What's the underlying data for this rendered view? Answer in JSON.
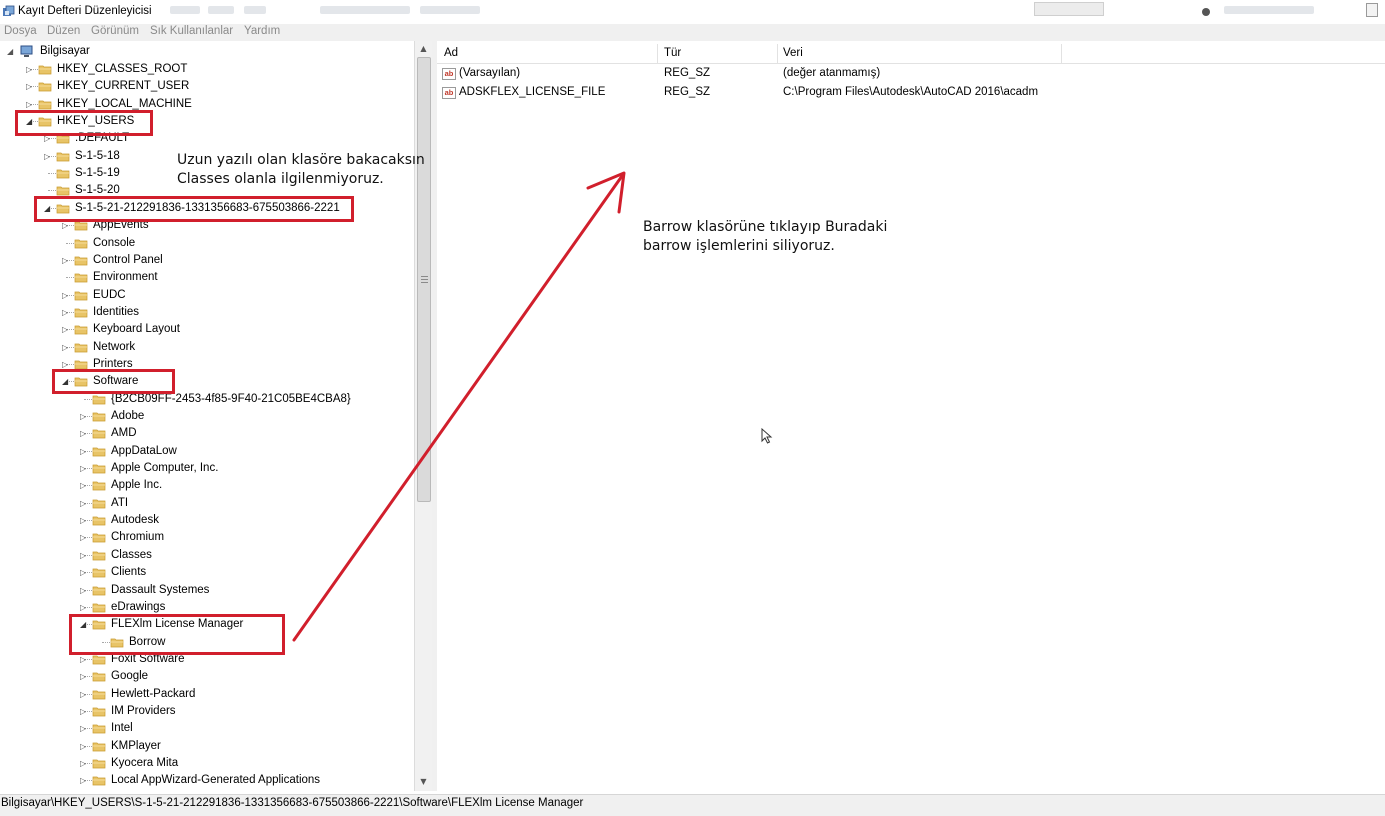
{
  "window": {
    "title": "Kayıt Defteri Düzenleyicisi"
  },
  "menu": [
    "Dosya",
    "Düzen",
    "Görünüm",
    "Sık Kullanılanlar",
    "Yardım"
  ],
  "tree": {
    "root": "Bilgisayar",
    "rows": [
      {
        "label": "HKEY_CLASSES_ROOT",
        "depth": 1,
        "arrow": "closed"
      },
      {
        "label": "HKEY_CURRENT_USER",
        "depth": 1,
        "arrow": "closed"
      },
      {
        "label": "HKEY_LOCAL_MACHINE",
        "depth": 1,
        "arrow": "closed"
      },
      {
        "label": "HKEY_USERS",
        "depth": 1,
        "arrow": "open"
      },
      {
        "label": ".DEFAULT",
        "depth": 2,
        "arrow": "closed"
      },
      {
        "label": "S-1-5-18",
        "depth": 2,
        "arrow": "closed"
      },
      {
        "label": "S-1-5-19",
        "depth": 2,
        "arrow": "none"
      },
      {
        "label": "S-1-5-20",
        "depth": 2,
        "arrow": "none"
      },
      {
        "label": "S-1-5-21-212291836-1331356683-675503866-2221",
        "depth": 2,
        "arrow": "open"
      },
      {
        "label": "AppEvents",
        "depth": 3,
        "arrow": "closed"
      },
      {
        "label": "Console",
        "depth": 3,
        "arrow": "none"
      },
      {
        "label": "Control Panel",
        "depth": 3,
        "arrow": "closed"
      },
      {
        "label": "Environment",
        "depth": 3,
        "arrow": "none"
      },
      {
        "label": "EUDC",
        "depth": 3,
        "arrow": "closed"
      },
      {
        "label": "Identities",
        "depth": 3,
        "arrow": "closed"
      },
      {
        "label": "Keyboard Layout",
        "depth": 3,
        "arrow": "closed"
      },
      {
        "label": "Network",
        "depth": 3,
        "arrow": "closed"
      },
      {
        "label": "Printers",
        "depth": 3,
        "arrow": "closed"
      },
      {
        "label": "Software",
        "depth": 3,
        "arrow": "open"
      },
      {
        "label": "{B2CB09FF-2453-4f85-9F40-21C05BE4CBA8}",
        "depth": 4,
        "arrow": "none"
      },
      {
        "label": "Adobe",
        "depth": 4,
        "arrow": "closed"
      },
      {
        "label": "AMD",
        "depth": 4,
        "arrow": "closed"
      },
      {
        "label": "AppDataLow",
        "depth": 4,
        "arrow": "closed"
      },
      {
        "label": "Apple Computer, Inc.",
        "depth": 4,
        "arrow": "closed"
      },
      {
        "label": "Apple Inc.",
        "depth": 4,
        "arrow": "closed"
      },
      {
        "label": "ATI",
        "depth": 4,
        "arrow": "closed"
      },
      {
        "label": "Autodesk",
        "depth": 4,
        "arrow": "closed"
      },
      {
        "label": "Chromium",
        "depth": 4,
        "arrow": "closed"
      },
      {
        "label": "Classes",
        "depth": 4,
        "arrow": "closed"
      },
      {
        "label": "Clients",
        "depth": 4,
        "arrow": "closed"
      },
      {
        "label": "Dassault Systemes",
        "depth": 4,
        "arrow": "closed"
      },
      {
        "label": "eDrawings",
        "depth": 4,
        "arrow": "closed"
      },
      {
        "label": "FLEXlm License Manager",
        "depth": 4,
        "arrow": "open",
        "selected": true
      },
      {
        "label": "Borrow",
        "depth": 5,
        "arrow": "none"
      },
      {
        "label": "Foxit Software",
        "depth": 4,
        "arrow": "closed"
      },
      {
        "label": "Google",
        "depth": 4,
        "arrow": "closed"
      },
      {
        "label": "Hewlett-Packard",
        "depth": 4,
        "arrow": "closed"
      },
      {
        "label": "IM Providers",
        "depth": 4,
        "arrow": "closed"
      },
      {
        "label": "Intel",
        "depth": 4,
        "arrow": "closed"
      },
      {
        "label": "KMPlayer",
        "depth": 4,
        "arrow": "closed"
      },
      {
        "label": "Kyocera Mita",
        "depth": 4,
        "arrow": "closed"
      },
      {
        "label": "Local AppWizard-Generated Applications",
        "depth": 4,
        "arrow": "closed"
      }
    ]
  },
  "list": {
    "columns": [
      "Ad",
      "Tür",
      "Veri"
    ],
    "rows": [
      {
        "name": "(Varsayılan)",
        "type": "REG_SZ",
        "data": "(değer atanmamış)"
      },
      {
        "name": "ADSKFLEX_LICENSE_FILE",
        "type": "REG_SZ",
        "data": "C:\\Program Files\\Autodesk\\AutoCAD 2016\\acadm"
      }
    ]
  },
  "status": {
    "path": "Bilgisayar\\HKEY_USERS\\S-1-5-21-212291836-1331356683-675503866-2221\\Software\\FLEXlm License Manager"
  },
  "annotations": {
    "note1": [
      "Uzun yazılı olan klasöre bakacaksın",
      "Classes olanla ilgilenmiyoruz."
    ],
    "note2": [
      "Barrow klasörüne tıklayıp Buradaki",
      "barrow işlemlerini siliyoruz."
    ],
    "color": "#d11f2c"
  },
  "colors": {
    "folder": "#e8c467",
    "folder_dark": "#c99a2e",
    "annotation_red": "#d11f2c"
  }
}
